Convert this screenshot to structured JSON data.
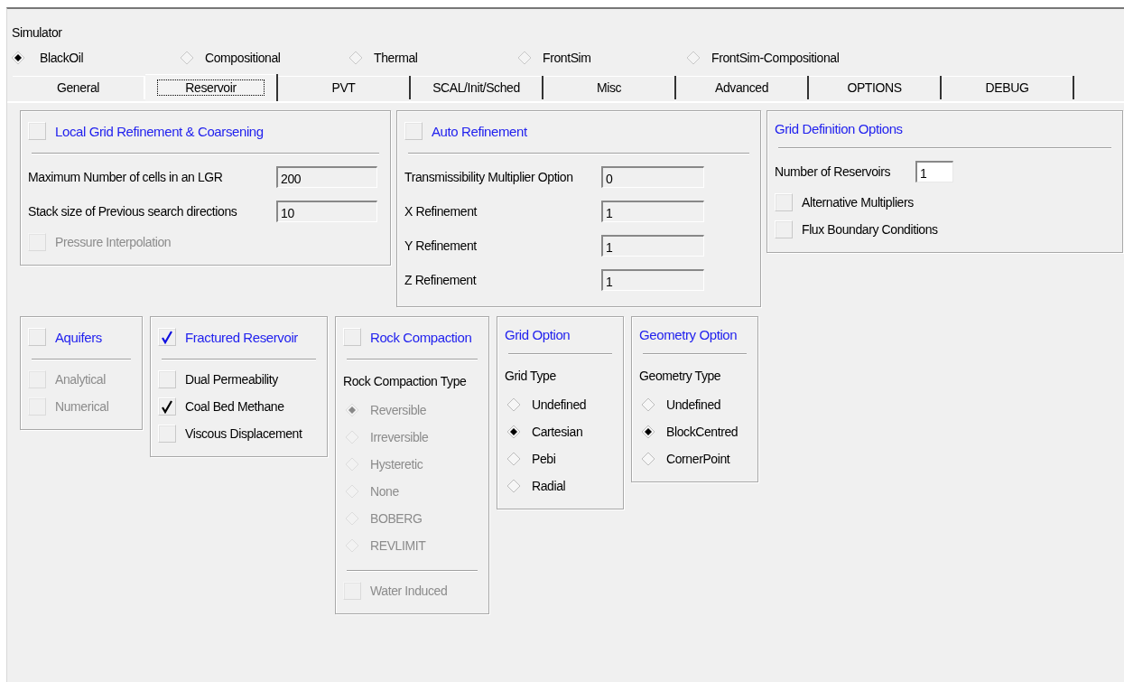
{
  "simulator": {
    "label": "Simulator",
    "options": [
      {
        "label": "BlackOil",
        "selected": true
      },
      {
        "label": "Compositional",
        "selected": false
      },
      {
        "label": "Thermal",
        "selected": false
      },
      {
        "label": "FrontSim",
        "selected": false
      },
      {
        "label": "FrontSim-Compositional",
        "selected": false
      }
    ]
  },
  "tabs": [
    {
      "label": "General",
      "selected": false
    },
    {
      "label": "Reservoir",
      "selected": true
    },
    {
      "label": "PVT",
      "selected": false
    },
    {
      "label": "SCAL/Init/Sched",
      "selected": false
    },
    {
      "label": "Misc",
      "selected": false
    },
    {
      "label": "Advanced",
      "selected": false
    },
    {
      "label": "OPTIONS",
      "selected": false
    },
    {
      "label": "DEBUG",
      "selected": false
    }
  ],
  "group_rows": [
    {
      "groups": [
        {
          "title": "Local Grid Refinement & Coarsening",
          "kind": "checkbox",
          "checked": false,
          "items": [
            {
              "kind": "field",
              "label": "Maximum Number of cells in an LGR",
              "value": "200",
              "readonly": true
            },
            {
              "kind": "field",
              "label": "Stack size of Previous search directions",
              "value": "10",
              "readonly": true
            },
            {
              "kind": "checkbox",
              "label": "Pressure Interpolation",
              "checked": false,
              "disabled": true
            }
          ]
        },
        {
          "title": "Auto Refinement",
          "kind": "checkbox",
          "checked": false,
          "items": [
            {
              "kind": "field",
              "label": "Transmissibility Multiplier Option",
              "value": "0",
              "readonly": true
            },
            {
              "kind": "field",
              "label": "X Refinement",
              "value": "1",
              "readonly": true
            },
            {
              "kind": "field",
              "label": "Y Refinement",
              "value": "1",
              "readonly": true
            },
            {
              "kind": "field",
              "label": "Z Refinement",
              "value": "1",
              "readonly": true
            }
          ]
        },
        {
          "title": "Grid Definition Options",
          "kind": "plain",
          "items": [
            {
              "kind": "field",
              "label": "Number of Reservoirs",
              "value": "1",
              "readonly": false
            },
            {
              "kind": "checkbox",
              "label": "Alternative Multipliers",
              "checked": false,
              "disabled": false
            },
            {
              "kind": "checkbox",
              "label": "Flux Boundary Conditions",
              "checked": false,
              "disabled": false
            }
          ]
        }
      ]
    },
    {
      "groups": [
        {
          "title": "Aquifers",
          "kind": "checkbox",
          "checked": false,
          "items": [
            {
              "kind": "checkbox",
              "label": "Analytical",
              "checked": false,
              "disabled": true
            },
            {
              "kind": "checkbox",
              "label": "Numerical",
              "checked": false,
              "disabled": true
            }
          ]
        },
        {
          "title": "Fractured Reservoir",
          "kind": "checkbox",
          "checked": true,
          "items": [
            {
              "kind": "checkbox",
              "label": "Dual Permeability",
              "checked": false,
              "disabled": false
            },
            {
              "kind": "checkbox",
              "label": "Coal Bed Methane",
              "checked": true,
              "disabled": false
            },
            {
              "kind": "checkbox",
              "label": "Viscous Displacement",
              "checked": false,
              "disabled": false
            }
          ]
        },
        {
          "title": "Rock Compaction",
          "kind": "checkbox",
          "checked": false,
          "items": [
            {
              "kind": "heading",
              "label": "Rock Compaction Type"
            },
            {
              "kind": "radio",
              "label": "Reversible",
              "selected": true,
              "disabled": true
            },
            {
              "kind": "radio",
              "label": "Irreversible",
              "selected": false,
              "disabled": true
            },
            {
              "kind": "radio",
              "label": "Hysteretic",
              "selected": false,
              "disabled": true
            },
            {
              "kind": "radio",
              "label": "None",
              "selected": false,
              "disabled": true
            },
            {
              "kind": "radio",
              "label": "BOBERG",
              "selected": false,
              "disabled": true
            },
            {
              "kind": "radio",
              "label": "REVLIMIT",
              "selected": false,
              "disabled": true
            },
            {
              "kind": "divider"
            },
            {
              "kind": "checkbox",
              "label": "Water Induced",
              "checked": false,
              "disabled": true
            }
          ]
        },
        {
          "title": "Grid Option",
          "kind": "plain",
          "items": [
            {
              "kind": "heading",
              "label": "Grid Type"
            },
            {
              "kind": "radio",
              "label": "Undefined",
              "selected": false,
              "disabled": false
            },
            {
              "kind": "radio",
              "label": "Cartesian",
              "selected": true,
              "disabled": false
            },
            {
              "kind": "radio",
              "label": "Pebi",
              "selected": false,
              "disabled": false
            },
            {
              "kind": "radio",
              "label": "Radial",
              "selected": false,
              "disabled": false
            }
          ]
        },
        {
          "title": "Geometry Option",
          "kind": "plain",
          "items": [
            {
              "kind": "heading",
              "label": "Geometry Type"
            },
            {
              "kind": "radio",
              "label": "Undefined",
              "selected": false,
              "disabled": false
            },
            {
              "kind": "radio",
              "label": "BlockCentred",
              "selected": true,
              "disabled": false
            },
            {
              "kind": "radio",
              "label": "CornerPoint",
              "selected": false,
              "disabled": false
            }
          ]
        }
      ]
    }
  ]
}
